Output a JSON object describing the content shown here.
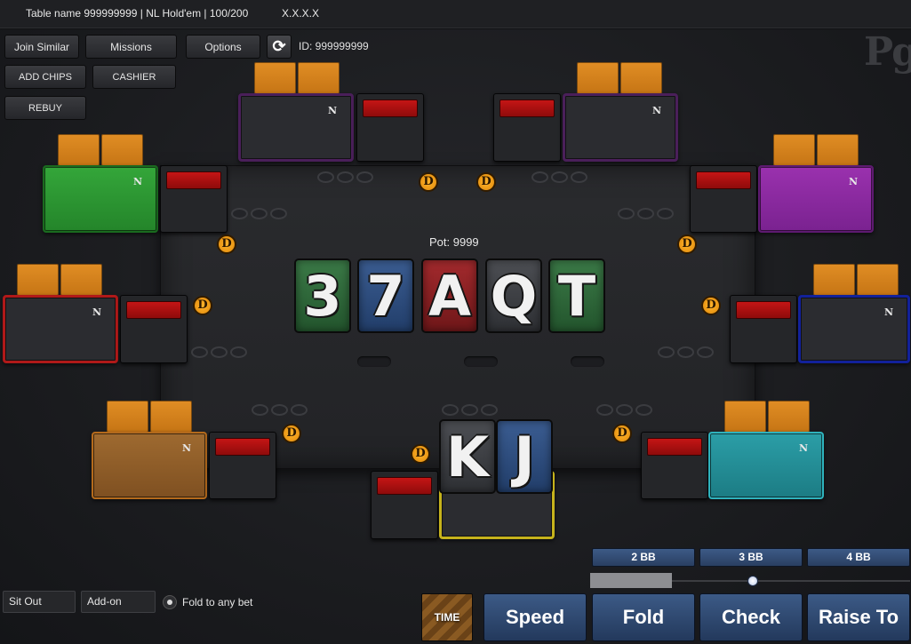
{
  "titlebar": {
    "table_info": "Table name 999999999 | NL Hold'em | 100/200",
    "version": "X.X.X.X"
  },
  "top_controls": {
    "join_similar": "Join Similar",
    "missions": "Missions",
    "options": "Options",
    "refresh_icon": "refresh-icon",
    "id_text": "ID: 999999999",
    "add_chips": "ADD CHIPS",
    "cashier": "CASHIER",
    "rebuy": "REBUY",
    "logo_text": "Pg"
  },
  "seats": [
    {
      "name": "top-left",
      "color": "#4a1f5a",
      "label": "N"
    },
    {
      "name": "top-right",
      "color": "#4a1f5a",
      "label": "N"
    },
    {
      "name": "upper-left",
      "color": "#2e9a34",
      "label": "N"
    },
    {
      "name": "upper-right",
      "color": "#8e2aa0",
      "label": "N"
    },
    {
      "name": "mid-left",
      "color": "#b01919",
      "label": "N"
    },
    {
      "name": "mid-right",
      "color": "#12219a",
      "label": "N"
    },
    {
      "name": "lower-left",
      "color": "#b46a1c",
      "label": "N"
    },
    {
      "name": "lower-right",
      "color": "#1f9aa3",
      "label": "N"
    },
    {
      "name": "hero",
      "color": "#c6b31c",
      "label": ""
    }
  ],
  "dealer_label": "D",
  "pot": "Pot: 9999",
  "board": [
    {
      "rank": "3",
      "suit_color": "green"
    },
    {
      "rank": "7",
      "suit_color": "blue"
    },
    {
      "rank": "A",
      "suit_color": "red"
    },
    {
      "rank": "Q",
      "suit_color": "grey"
    },
    {
      "rank": "T",
      "suit_color": "green"
    }
  ],
  "hero_cards": [
    {
      "rank": "K",
      "suit_color": "grey"
    },
    {
      "rank": "J",
      "suit_color": "blue"
    }
  ],
  "bet_presets": [
    "2 BB",
    "3 BB",
    "4 BB"
  ],
  "bet_slider_fraction": 0.34,
  "actions": {
    "time": "TIME",
    "speed": "Speed",
    "fold": "Fold",
    "check": "Check",
    "raise": "Raise To"
  },
  "bottom_left": {
    "sit_out": "Sit Out",
    "add_on": "Add-on",
    "fold_to_any": "Fold to any bet"
  }
}
